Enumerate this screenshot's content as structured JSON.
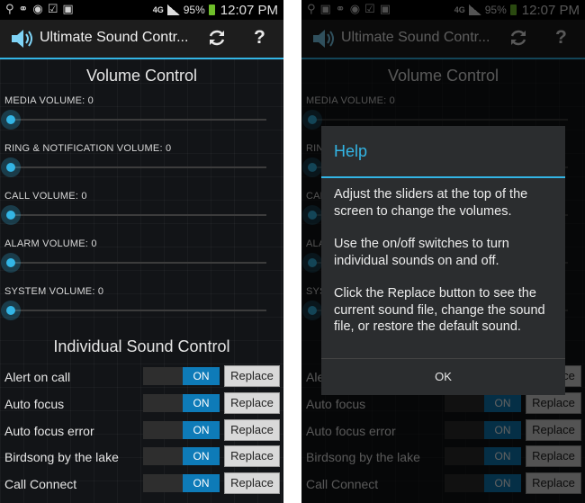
{
  "status_bar": {
    "battery": "95%",
    "network": "4G",
    "time": "12:07 PM"
  },
  "app": {
    "title": "Ultimate Sound Contr...",
    "accent_color": "#33b5e5"
  },
  "volume_section": {
    "title": "Volume Control",
    "sliders": [
      {
        "label": "MEDIA VOLUME: 0",
        "value": 0
      },
      {
        "label": "RING & NOTIFICATION VOLUME: 0",
        "value": 0
      },
      {
        "label": "CALL VOLUME: 0",
        "value": 0
      },
      {
        "label": "ALARM VOLUME: 0",
        "value": 0
      },
      {
        "label": "SYSTEM VOLUME: 0",
        "value": 0
      }
    ]
  },
  "sound_section": {
    "title": "Individual Sound Control",
    "switch_label": "ON",
    "replace_label": "Replace",
    "sounds": [
      "Alert on call",
      "Auto focus",
      "Auto focus error",
      "Birdsong by the lake",
      "Call Connect"
    ]
  },
  "help_dialog": {
    "title": "Help",
    "paragraphs": [
      "Adjust the sliders at the top of the screen to change the volumes.",
      "Use the on/off switches to turn individual sounds on and off.",
      "Click the Replace button to see the current sound file, change the sound file, or restore the default sound."
    ],
    "ok_label": "OK"
  }
}
